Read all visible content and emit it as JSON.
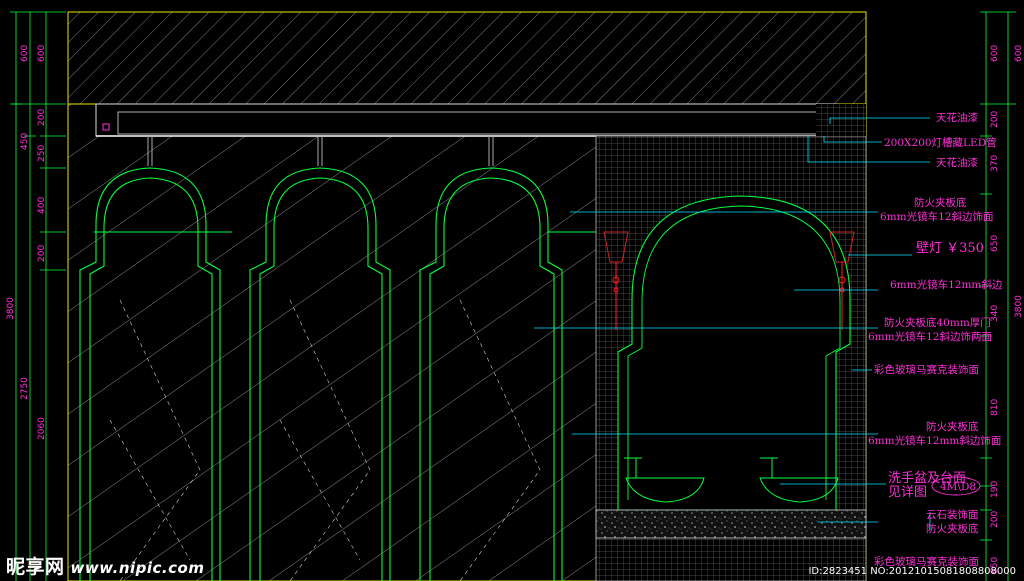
{
  "annotations": [
    {
      "id": "a1",
      "text": "天花油漆"
    },
    {
      "id": "a2",
      "text": "200X200灯槽藏LED管"
    },
    {
      "id": "a3",
      "text": "天花油漆"
    },
    {
      "id": "a4a",
      "text": "防火夹板底"
    },
    {
      "id": "a4b",
      "text": "6mm光镜车12斜边饰面"
    },
    {
      "id": "a5",
      "text": "壁灯 ￥350"
    },
    {
      "id": "a6",
      "text": "6mm光镜车12mm斜边"
    },
    {
      "id": "a7a",
      "text": "防火夹板底40mm厚门"
    },
    {
      "id": "a7b",
      "text": "6mm光镜车12斜边饰两面"
    },
    {
      "id": "a8",
      "text": "彩色玻璃马赛克装饰面"
    },
    {
      "id": "a9a",
      "text": "防火夹板底"
    },
    {
      "id": "a9b",
      "text": "6mm光镜车12mm斜边饰面"
    },
    {
      "id": "a10a",
      "text": "洗手盆及台面"
    },
    {
      "id": "a10b",
      "text": "见详图"
    },
    {
      "id": "a11a",
      "text": "云石装饰面"
    },
    {
      "id": "a11b",
      "text": "防火夹板底"
    },
    {
      "id": "a12",
      "text": "彩色玻璃马赛克装饰面"
    }
  ],
  "tag": "4M\\D8",
  "left_dims": {
    "inner": [
      "600",
      "200",
      "250",
      "400",
      "200",
      "2060"
    ],
    "mid": [
      "450",
      "2750"
    ],
    "outer": [
      "600",
      "3800"
    ]
  },
  "right_dims": {
    "inner": [
      "600",
      "200",
      "370",
      "650",
      "340",
      "810",
      "190",
      "200",
      "650"
    ],
    "outer": [
      "600",
      "3800"
    ]
  },
  "watermark": {
    "cn": "昵享网",
    "url": "www.nipic.com"
  },
  "image_id": "ID:2823451 NO:20121015081808808000",
  "colors": {
    "annotation": "#ff2fd8",
    "leader": "#00e5ff",
    "outline": "#00ff3c",
    "frame": "#e6e600",
    "hatch": "#ffffff",
    "mosaic": "#5a5a5a"
  }
}
